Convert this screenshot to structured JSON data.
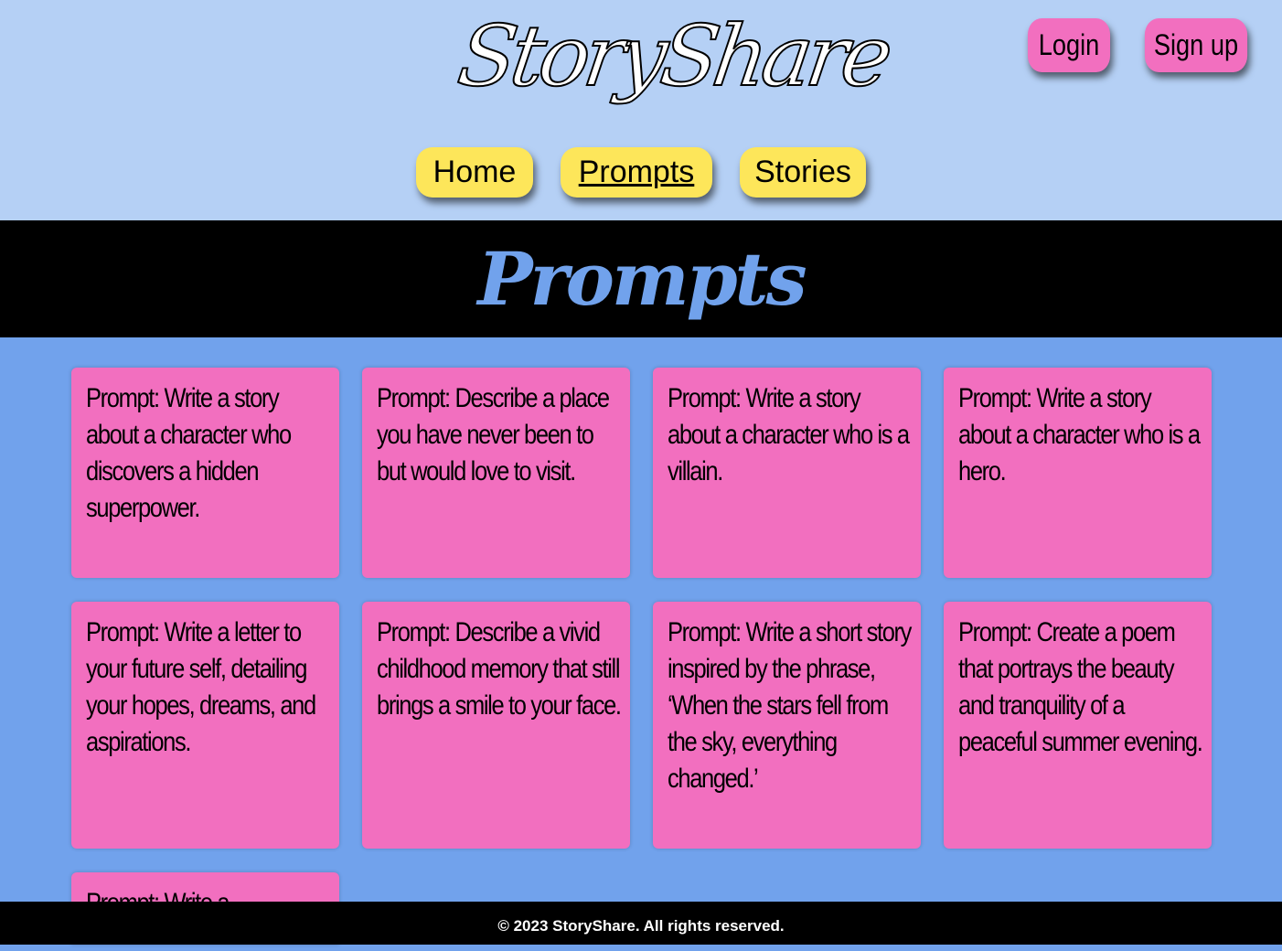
{
  "header": {
    "logo": "StoryShare",
    "login": "Login",
    "signup": "Sign up",
    "nav": [
      {
        "label": "Home"
      },
      {
        "label": "Prompts",
        "active": true
      },
      {
        "label": "Stories"
      }
    ]
  },
  "page_title": "Prompts",
  "prompts": [
    "Prompt: Write a story about a character who discovers a hidden superpower.",
    "Prompt: Describe a place you have never been to but would love to visit.",
    "Prompt: Write a story about a character who is a villain.",
    "Prompt: Write a story about a character who is a hero.",
    "Prompt: Write a letter to your future self, detailing your hopes, dreams, and aspirations.",
    "Prompt: Describe a vivid childhood memory that still brings a smile to your face.",
    "Prompt: Write a short story inspired by the phrase, ‘When the stars fell from the sky, everything changed.’",
    "Prompt: Create a poem that portrays the beauty and tranquility of a peaceful summer evening.",
    "Prompt: Write a"
  ],
  "footer": "© 2023 StoryShare. All rights reserved.",
  "colors": {
    "header_bg": "#b5d0f5",
    "body_bg": "#71a2ec",
    "card": "#f26fbf",
    "nav": "#fde65a"
  }
}
